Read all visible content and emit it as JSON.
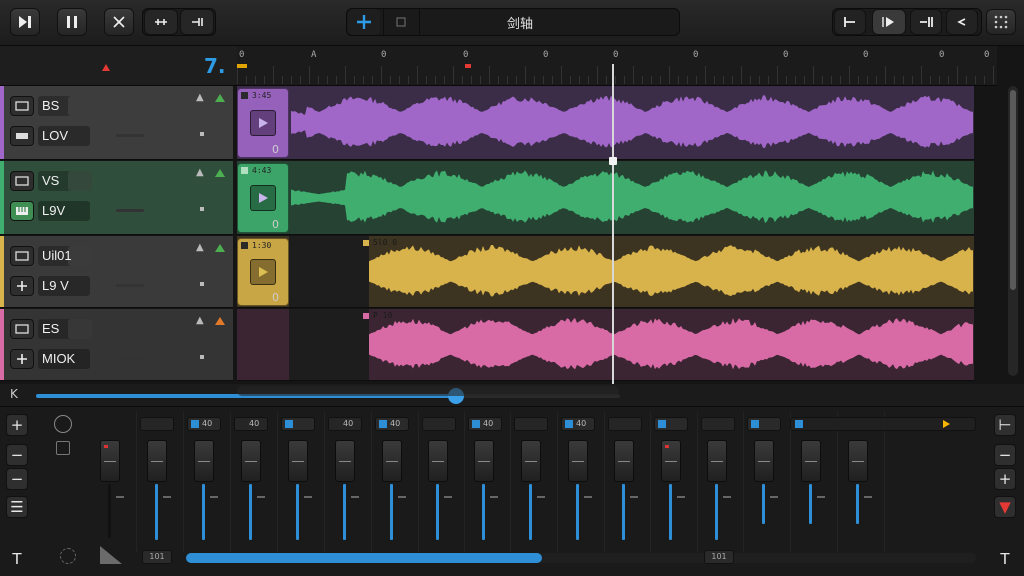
{
  "title": "剑轴",
  "colors": {
    "accent": "#2e8fd6",
    "purple": "#a067c8",
    "green": "#3fae6f",
    "yellow": "#d8b24a",
    "pink": "#d86aa6"
  },
  "toolbar": {
    "left_icons": [
      "skip-to-end-icon",
      "pause-icon",
      "shuffle-icon",
      "link-icon",
      "record-marker-icon"
    ],
    "center_icons": [
      "add-icon",
      "grid-icon"
    ],
    "right_icons": [
      "marker-start-icon",
      "play-icon",
      "loop-end-icon",
      "volume-icon",
      "grid-dots-icon"
    ]
  },
  "ruler": {
    "labels": [
      "0",
      "A",
      "0",
      "0",
      "0",
      "0",
      "0",
      "0",
      "0",
      "0",
      "0"
    ],
    "left_marker": "7."
  },
  "tracks": [
    {
      "name_top": "BS",
      "name_bottom": "LOV",
      "color": "#a067c8",
      "clip_label": "3:45",
      "clip_num": "0",
      "row_icon": "guitar-icon"
    },
    {
      "name_top": "VS",
      "name_bottom": "L9V",
      "color": "#3fae6f",
      "clip_label": "4:43",
      "clip_num": "0",
      "row_icon": "piano-icon"
    },
    {
      "name_top": "Uil01",
      "name_bottom": "L9 V",
      "color": "#d8b24a",
      "clip_label": "1:30",
      "clip_num": "0",
      "row_icon": "plus-icon",
      "clip2_label": "5l0 0"
    },
    {
      "name_top": "ES",
      "name_bottom": "MIOK",
      "color": "#d86aa6",
      "clip_label": "P 10",
      "row_icon": "plus-icon"
    }
  ],
  "scrub": {
    "left_glyph": "K",
    "position": 0.72
  },
  "mixer": {
    "side_left": [
      "+",
      "−",
      "−",
      "☰",
      "T"
    ],
    "side_right": [
      "⊢",
      "−",
      "+",
      "▼",
      "T"
    ],
    "channel_tops": [
      "",
      "40",
      "40",
      "",
      "40",
      "40",
      "",
      "40",
      "",
      "40",
      "",
      "",
      "",
      ""
    ],
    "bottom_chips": [
      "101",
      "101"
    ],
    "bottom_fill": 0.45
  }
}
